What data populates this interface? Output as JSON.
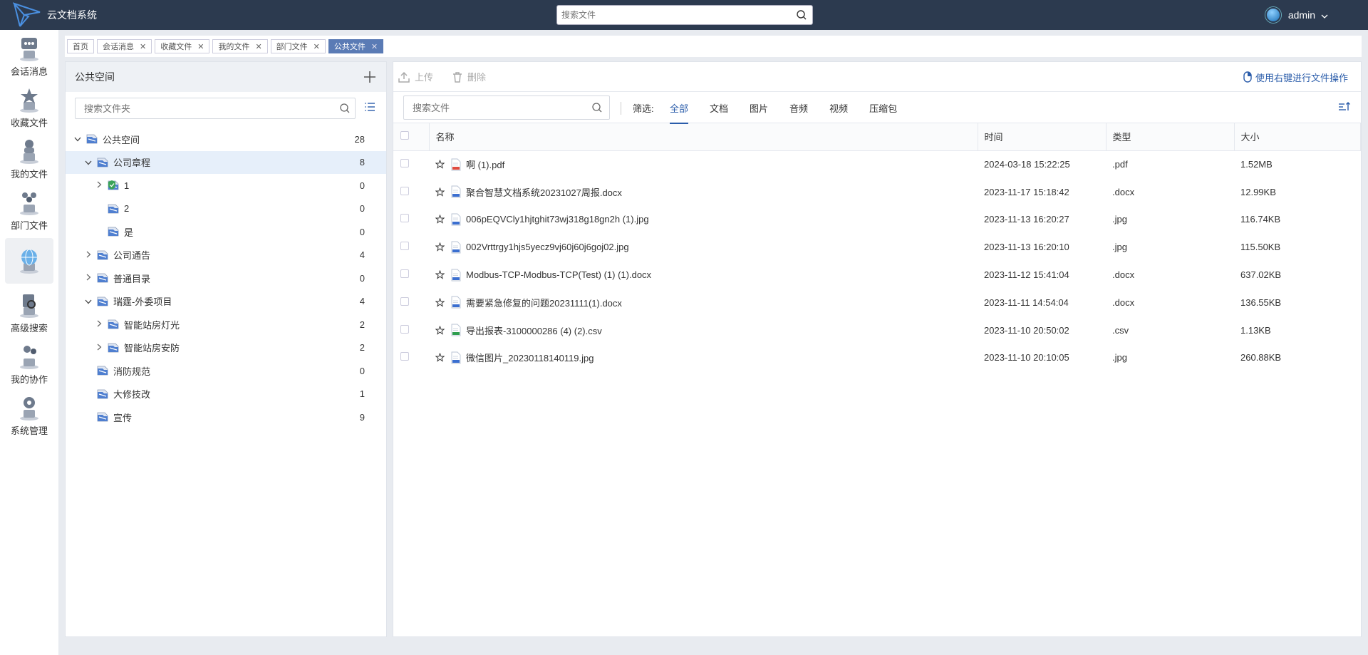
{
  "app": {
    "title": "云文档系统",
    "search_placeholder": "搜索文件",
    "username": "admin"
  },
  "leftnav": [
    {
      "label": "会话消息",
      "icon": "message-icon"
    },
    {
      "label": "收藏文件",
      "icon": "favorite-icon"
    },
    {
      "label": "我的文件",
      "icon": "my-files-icon"
    },
    {
      "label": "部门文件",
      "icon": "department-icon"
    },
    {
      "label": "",
      "icon": "globe-icon",
      "active": true
    },
    {
      "label": "高级搜索",
      "icon": "advanced-search-icon"
    },
    {
      "label": "我的协作",
      "icon": "collaboration-icon"
    },
    {
      "label": "系统管理",
      "icon": "system-admin-icon"
    }
  ],
  "tabs": [
    {
      "label": "首页",
      "closable": false
    },
    {
      "label": "会话消息",
      "closable": true
    },
    {
      "label": "收藏文件",
      "closable": true
    },
    {
      "label": "我的文件",
      "closable": true
    },
    {
      "label": "部门文件",
      "closable": true
    },
    {
      "label": "公共文件",
      "closable": true,
      "active": true
    }
  ],
  "folder_panel": {
    "title": "公共空间",
    "search_placeholder": "搜索文件夹",
    "tree": [
      {
        "name": "公共空间",
        "count": "28",
        "level": 0,
        "caret": "down"
      },
      {
        "name": "公司章程",
        "count": "8",
        "level": 1,
        "caret": "down",
        "selected": true
      },
      {
        "name": "1",
        "count": "0",
        "level": 2,
        "caret": "right",
        "shield": true
      },
      {
        "name": "2",
        "count": "0",
        "level": 2,
        "caret": ""
      },
      {
        "name": "是",
        "count": "0",
        "level": 2,
        "caret": ""
      },
      {
        "name": "公司通告",
        "count": "4",
        "level": 1,
        "caret": "right"
      },
      {
        "name": "普通目录",
        "count": "0",
        "level": 1,
        "caret": "right"
      },
      {
        "name": "瑞霆-外委项目",
        "count": "4",
        "level": 1,
        "caret": "down"
      },
      {
        "name": "智能站房灯光",
        "count": "2",
        "level": 2,
        "caret": "right"
      },
      {
        "name": "智能站房安防",
        "count": "2",
        "level": 2,
        "caret": "right"
      },
      {
        "name": "消防规范",
        "count": "0",
        "level": 1,
        "caret": ""
      },
      {
        "name": "大修技改",
        "count": "1",
        "level": 1,
        "caret": ""
      },
      {
        "name": "宣传",
        "count": "9",
        "level": 1,
        "caret": ""
      }
    ]
  },
  "toolbar": {
    "upload_label": "上传",
    "delete_label": "删除",
    "hint": "使用右键进行文件操作"
  },
  "filter": {
    "search_placeholder": "搜索文件",
    "label": "筛选:",
    "tabs": [
      "全部",
      "文档",
      "图片",
      "音频",
      "视频",
      "压缩包"
    ],
    "active": "全部"
  },
  "table": {
    "headers": {
      "name": "名称",
      "time": "时间",
      "type": "类型",
      "size": "大小"
    },
    "rows": [
      {
        "name": "啊 (1).pdf",
        "time": "2024-03-18 15:22:25",
        "type": ".pdf",
        "size": "1.52MB",
        "icon": "pdf-file-icon"
      },
      {
        "name": "聚合智慧文档系统20231027周报.docx",
        "time": "2023-11-17 15:18:42",
        "type": ".docx",
        "size": "12.99KB",
        "icon": "doc-file-icon"
      },
      {
        "name": "006pEQVCly1hjtghit73wj318g18gn2h (1).jpg",
        "time": "2023-11-13 16:20:27",
        "type": ".jpg",
        "size": "116.74KB",
        "icon": "image-file-icon"
      },
      {
        "name": "002Vrttrgy1hjs5yecz9vj60j60j6goj02.jpg",
        "time": "2023-11-13 16:20:10",
        "type": ".jpg",
        "size": "115.50KB",
        "icon": "image-file-icon"
      },
      {
        "name": "Modbus-TCP-Modbus-TCP(Test) (1) (1).docx",
        "time": "2023-11-12 15:41:04",
        "type": ".docx",
        "size": "637.02KB",
        "icon": "doc-file-icon"
      },
      {
        "name": "需要紧急修复的问题20231111(1).docx",
        "time": "2023-11-11 14:54:04",
        "type": ".docx",
        "size": "136.55KB",
        "icon": "doc-file-icon"
      },
      {
        "name": "导出报表-3100000286 (4) (2).csv",
        "time": "2023-11-10 20:50:02",
        "type": ".csv",
        "size": "1.13KB",
        "icon": "csv-file-icon"
      },
      {
        "name": "微信图片_20230118140119.jpg",
        "time": "2023-11-10 20:10:05",
        "type": ".jpg",
        "size": "260.88KB",
        "icon": "image-file-icon"
      }
    ]
  },
  "colors": {
    "topbar": "#2c3a4f",
    "accent": "#2a5caa",
    "active_tab": "#5a7bb5"
  }
}
